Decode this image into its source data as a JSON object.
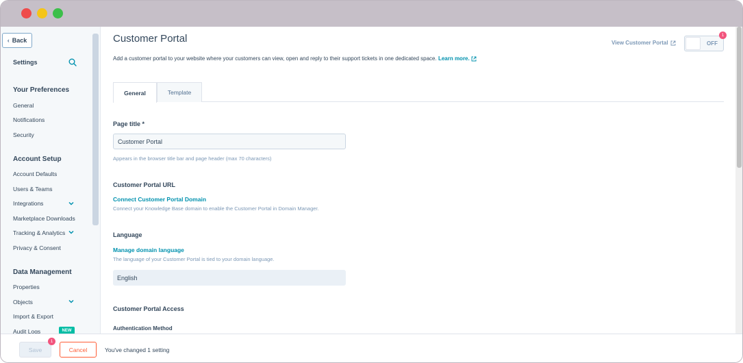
{
  "sidebar": {
    "back_label": "Back",
    "settings_label": "Settings",
    "sections": {
      "preferences": {
        "title": "Your Preferences",
        "items": [
          "General",
          "Notifications",
          "Security"
        ]
      },
      "account_setup": {
        "title": "Account Setup",
        "items": [
          "Account Defaults",
          "Users & Teams",
          "Integrations",
          "Marketplace Downloads",
          "Tracking & Analytics",
          "Privacy & Consent"
        ]
      },
      "data_management": {
        "title": "Data Management",
        "items": [
          "Properties",
          "Objects",
          "Import & Export",
          "Audit Logs"
        ]
      }
    },
    "new_badge": "NEW"
  },
  "header": {
    "title": "Customer Portal",
    "description": "Add a customer portal to your website where your customers can view, open and reply to their support tickets in one dedicated space.",
    "learn_more": "Learn more.",
    "view_portal": "View Customer Portal",
    "toggle_label": "OFF",
    "toggle_badge": "1"
  },
  "tabs": [
    "General",
    "Template"
  ],
  "form": {
    "page_title_label": "Page title *",
    "page_title_value": "Customer Portal",
    "page_title_help": "Appears in the browser title bar and page header (max 70 characters)",
    "url_label": "Customer Portal URL",
    "url_link": "Connect Customer Portal Domain",
    "url_help": "Connect your Knowledge Base domain to enable the Customer Portal in Domain Manager.",
    "language_label": "Language",
    "language_link": "Manage domain language",
    "language_help": "The language of your Customer Portal is tied to your domain language.",
    "language_value": "English",
    "access_label": "Customer Portal Access",
    "auth_label": "Authentication Method"
  },
  "footer": {
    "save_label": "Save",
    "save_badge": "1",
    "cancel_label": "Cancel",
    "message": "You've changed 1 setting"
  },
  "colors": {
    "accent_link": "#0091ae",
    "cancel": "#ff5c35",
    "badge": "#f2547d",
    "new_badge": "#00bda5"
  }
}
